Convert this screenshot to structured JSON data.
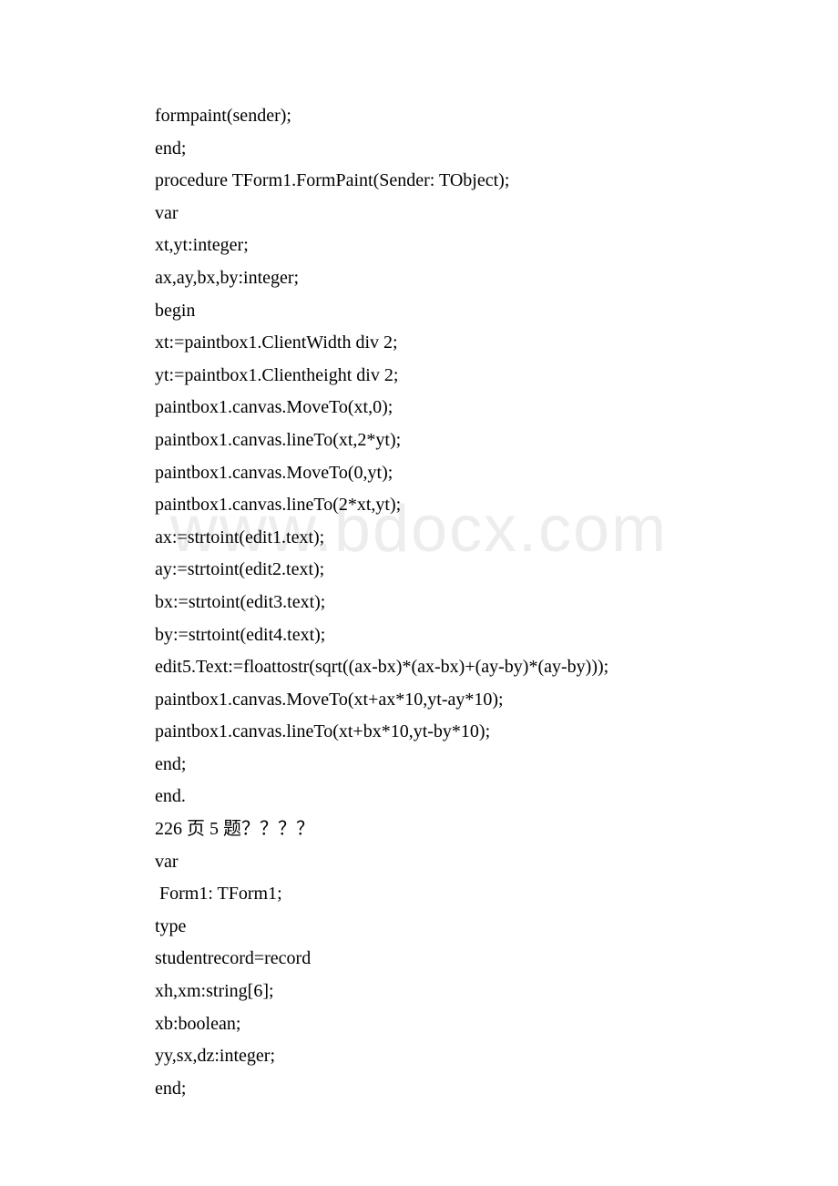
{
  "watermark": "www.bdocx.com",
  "code": {
    "lines": [
      "formpaint(sender);",
      "end;",
      "procedure TForm1.FormPaint(Sender: TObject);",
      "var",
      "xt,yt:integer;",
      "ax,ay,bx,by:integer;",
      "begin",
      "xt:=paintbox1.ClientWidth div 2;",
      "yt:=paintbox1.Clientheight div 2;",
      "paintbox1.canvas.MoveTo(xt,0);",
      "paintbox1.canvas.lineTo(xt,2*yt);",
      "paintbox1.canvas.MoveTo(0,yt);",
      "paintbox1.canvas.lineTo(2*xt,yt);",
      "ax:=strtoint(edit1.text);",
      "ay:=strtoint(edit2.text);",
      "bx:=strtoint(edit3.text);",
      "by:=strtoint(edit4.text);",
      "edit5.Text:=floattostr(sqrt((ax-bx)*(ax-bx)+(ay-by)*(ay-by)));",
      "paintbox1.canvas.MoveTo(xt+ax*10,yt-ay*10);",
      "paintbox1.canvas.lineTo(xt+bx*10,yt-by*10);",
      "end;",
      "end.",
      "226 页 5 题？？？？",
      "var",
      " Form1: TForm1;",
      "type",
      "studentrecord=record",
      "xh,xm:string[6];",
      "xb:boolean;",
      "yy,sx,dz:integer;",
      "end;"
    ]
  }
}
